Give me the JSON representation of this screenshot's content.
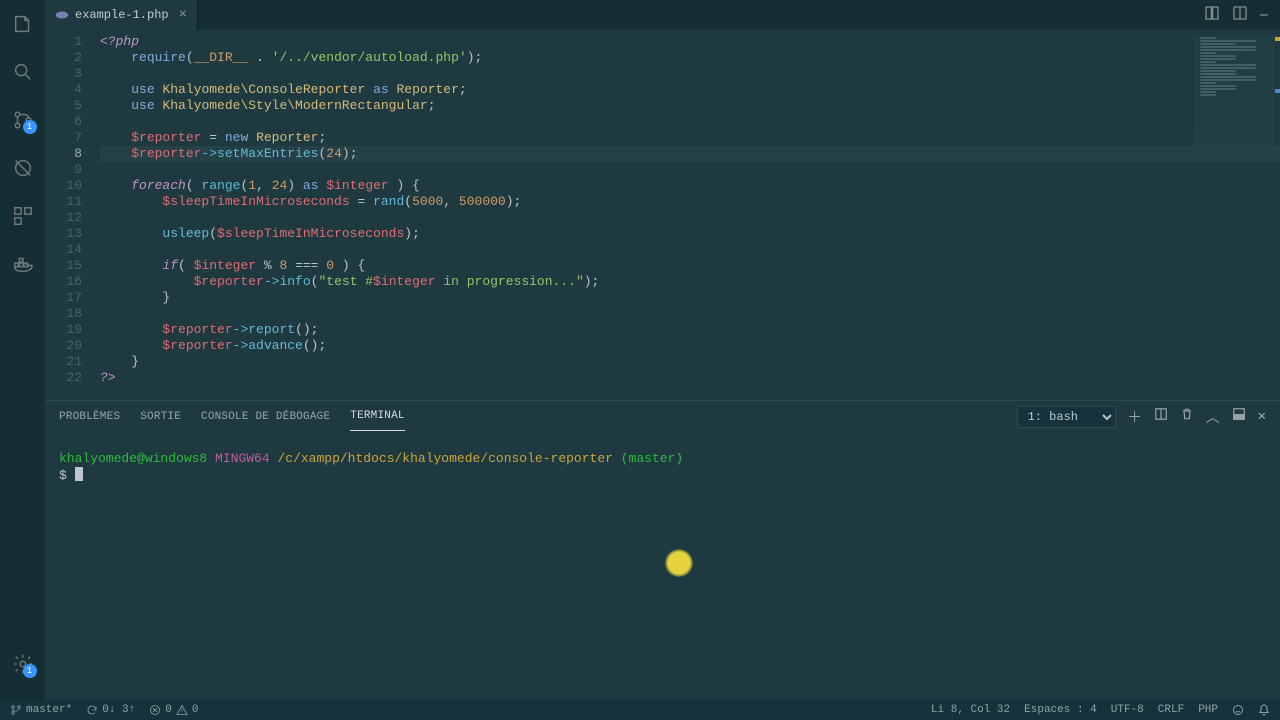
{
  "tab": {
    "filename": "example-1.php"
  },
  "code_lines": [
    {
      "n": 1,
      "tokens": [
        [
          "kw",
          "<?php"
        ]
      ]
    },
    {
      "n": 2,
      "indent": 2,
      "tokens": [
        [
          "kw2",
          "require"
        ],
        [
          "pn",
          "("
        ],
        [
          "const",
          "__DIR__"
        ],
        [
          "pn",
          " . "
        ],
        [
          "str",
          "'/../vendor/autoload.php'"
        ],
        [
          "pn",
          ");"
        ]
      ]
    },
    {
      "n": 3,
      "tokens": []
    },
    {
      "n": 4,
      "indent": 2,
      "tokens": [
        [
          "kw2",
          "use "
        ],
        [
          "ns",
          "Khalyomede\\ConsoleReporter"
        ],
        [
          "kw2",
          " as "
        ],
        [
          "ns",
          "Reporter"
        ],
        [
          "pn",
          ";"
        ]
      ]
    },
    {
      "n": 5,
      "indent": 2,
      "tokens": [
        [
          "kw2",
          "use "
        ],
        [
          "ns",
          "Khalyomede\\Style\\ModernRectangular"
        ],
        [
          "pn",
          ";"
        ]
      ]
    },
    {
      "n": 6,
      "tokens": []
    },
    {
      "n": 7,
      "indent": 2,
      "tokens": [
        [
          "var",
          "$reporter"
        ],
        [
          "pn",
          " = "
        ],
        [
          "kw2",
          "new "
        ],
        [
          "ns",
          "Reporter"
        ],
        [
          "pn",
          ";"
        ]
      ]
    },
    {
      "n": 8,
      "indent": 2,
      "hl": true,
      "tokens": [
        [
          "var",
          "$reporter"
        ],
        [
          "op",
          "->"
        ],
        [
          "fn",
          "setMaxEntries"
        ],
        [
          "pn",
          "("
        ],
        [
          "num",
          "24"
        ],
        [
          "pn",
          ");"
        ]
      ]
    },
    {
      "n": 9,
      "tokens": []
    },
    {
      "n": 10,
      "indent": 2,
      "tokens": [
        [
          "kw",
          "foreach"
        ],
        [
          "pn",
          "( "
        ],
        [
          "fn",
          "range"
        ],
        [
          "pn",
          "("
        ],
        [
          "num",
          "1"
        ],
        [
          "pn",
          ", "
        ],
        [
          "num",
          "24"
        ],
        [
          "pn",
          ") "
        ],
        [
          "kw2",
          "as "
        ],
        [
          "var",
          "$integer"
        ],
        [
          "pn",
          " ) {"
        ]
      ]
    },
    {
      "n": 11,
      "indent": 4,
      "tokens": [
        [
          "var",
          "$sleepTimeInMicroseconds"
        ],
        [
          "pn",
          " = "
        ],
        [
          "fn",
          "rand"
        ],
        [
          "pn",
          "("
        ],
        [
          "num",
          "5000"
        ],
        [
          "pn",
          ", "
        ],
        [
          "num",
          "500000"
        ],
        [
          "pn",
          ");"
        ]
      ]
    },
    {
      "n": 12,
      "tokens": []
    },
    {
      "n": 13,
      "indent": 4,
      "tokens": [
        [
          "fn",
          "usleep"
        ],
        [
          "pn",
          "("
        ],
        [
          "var",
          "$sleepTimeInMicroseconds"
        ],
        [
          "pn",
          ");"
        ]
      ]
    },
    {
      "n": 14,
      "tokens": []
    },
    {
      "n": 15,
      "indent": 4,
      "tokens": [
        [
          "kw",
          "if"
        ],
        [
          "pn",
          "( "
        ],
        [
          "var",
          "$integer"
        ],
        [
          "pn",
          " % "
        ],
        [
          "num",
          "8"
        ],
        [
          "pn",
          " === "
        ],
        [
          "num",
          "0"
        ],
        [
          "pn",
          " ) {"
        ]
      ]
    },
    {
      "n": 16,
      "indent": 6,
      "tokens": [
        [
          "var",
          "$reporter"
        ],
        [
          "op",
          "->"
        ],
        [
          "fn",
          "info"
        ],
        [
          "pn",
          "("
        ],
        [
          "str",
          "\"test #"
        ],
        [
          "var",
          "$integer"
        ],
        [
          "str",
          " in progression...\""
        ],
        [
          "pn",
          ");"
        ]
      ]
    },
    {
      "n": 17,
      "indent": 4,
      "tokens": [
        [
          "pn",
          "}"
        ]
      ]
    },
    {
      "n": 18,
      "tokens": []
    },
    {
      "n": 19,
      "indent": 4,
      "tokens": [
        [
          "var",
          "$reporter"
        ],
        [
          "op",
          "->"
        ],
        [
          "fn",
          "report"
        ],
        [
          "pn",
          "();"
        ]
      ]
    },
    {
      "n": 20,
      "indent": 4,
      "tokens": [
        [
          "var",
          "$reporter"
        ],
        [
          "op",
          "->"
        ],
        [
          "fn",
          "advance"
        ],
        [
          "pn",
          "();"
        ]
      ]
    },
    {
      "n": 21,
      "indent": 2,
      "tokens": [
        [
          "pn",
          "}"
        ]
      ]
    },
    {
      "n": 22,
      "tokens": [
        [
          "kw",
          "?>"
        ]
      ]
    }
  ],
  "panel": {
    "tabs": {
      "problems": "PROBLÈMES",
      "output": "SORTIE",
      "debug": "CONSOLE DE DÉBOGAGE",
      "terminal": "TERMINAL"
    },
    "shell_option": "1: bash"
  },
  "terminal": {
    "user": "khalyomede@windows8",
    "host": "MINGW64",
    "cwd": "/c/xampp/htdocs/khalyomede/console-reporter",
    "branch": "(master)",
    "promptchar": "$"
  },
  "statusbar": {
    "branch": "master*",
    "sync": "0↓ 3↑",
    "errors": "0",
    "warnings": "0",
    "lncol": "Li 8, Col 32",
    "spaces": "Espaces : 4",
    "encoding": "UTF-8",
    "eol": "CRLF",
    "lang": "PHP"
  },
  "scm_badge": "1"
}
